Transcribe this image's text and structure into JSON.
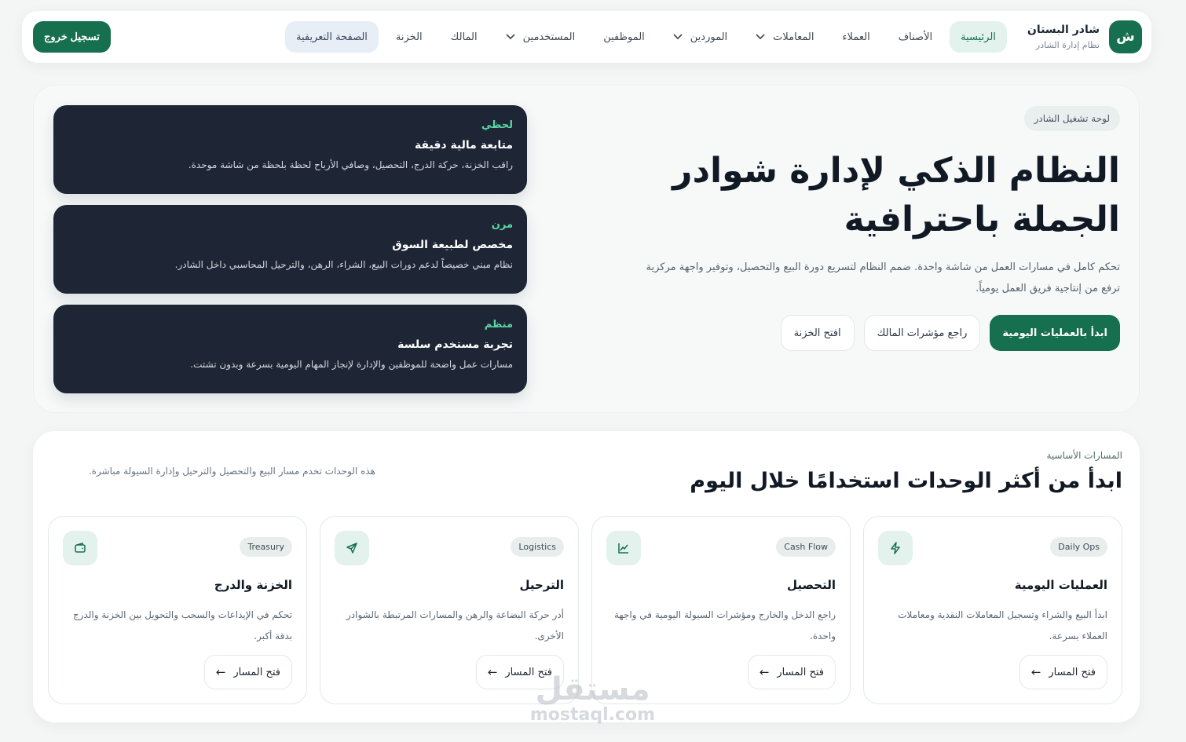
{
  "brand": {
    "initial": "ش",
    "name": "شادر البستان",
    "subtitle": "نظام إدارة الشادر"
  },
  "nav": {
    "items": [
      {
        "label": "الرئيسية",
        "active": true
      },
      {
        "label": "الأصناف"
      },
      {
        "label": "العملاء"
      },
      {
        "label": "المعاملات",
        "dropdown": true
      },
      {
        "label": "الموردين",
        "dropdown": true
      },
      {
        "label": "الموظفين"
      },
      {
        "label": "المستخدمين",
        "dropdown": true
      },
      {
        "label": "المالك"
      },
      {
        "label": "الخزنة"
      },
      {
        "label": "الصفحة التعريفية"
      }
    ],
    "logout_label": "تسجيل خروج"
  },
  "hero": {
    "pill": "لوحة تشغيل الشادر",
    "title": "النظام الذكي لإدارة شوادر الجملة باحترافية",
    "description": "تحكم كامل في مسارات العمل من شاشة واحدة. ضمم النظام لتسريع دورة البيع والتحصيل، وتوفير واجهة مركزية ترفع من إنتاجية فريق العمل يومياً.",
    "primary_button": "ابدأ بالعمليات اليومية",
    "secondary_button": "راجع مؤشرات المالك",
    "tertiary_button": "افتح الخزنة",
    "features": [
      {
        "tag": "لحظي",
        "title": "متابعة مالية دقيقة",
        "description": "راقب الخزنة، حركة الدرج، التحصيل، وصافي الأرباح لحظة بلحظة من شاشة موحدة."
      },
      {
        "tag": "مرن",
        "title": "مخصص لطبيعة السوق",
        "description": "نظام مبني خصيصاً لدعم دورات البيع، الشراء، الرهن، والترحيل المحاسبي داخل الشادر."
      },
      {
        "tag": "منظم",
        "title": "تجربة مستخدم سلسة",
        "description": "مسارات عمل واضحة للموظفين والإدارة لإنجاز المهام اليومية بسرعة وبدون تشتت."
      }
    ]
  },
  "paths": {
    "kicker": "المسارات الأساسية",
    "title": "ابدأ من أكثر الوحدات استخدامًا خلال اليوم",
    "description": "هذه الوحدات تخدم مسار البيع والتحصيل والترحيل وإدارة السيولة مباشرة.",
    "modules": [
      {
        "badge": "Daily Ops",
        "icon": "bolt-icon",
        "title": "العمليات اليومية",
        "description": "ابدأ البيع والشراء وتسجيل المعاملات النقدية ومعاملات العملاء بسرعة.",
        "button": "فتح المسار"
      },
      {
        "badge": "Cash Flow",
        "icon": "trend-chart-icon",
        "title": "التحصيل",
        "description": "راجع الدخل والخارج ومؤشرات السيولة اليومية في واجهة واحدة.",
        "button": "فتح المسار"
      },
      {
        "badge": "Logistics",
        "icon": "send-icon",
        "title": "الترحيل",
        "description": "أدر حركة البضاعة والرهن والمسارات المرتبطة بالشوادر الأخرى.",
        "button": "فتح المسار"
      },
      {
        "badge": "Treasury",
        "icon": "wallet-icon",
        "title": "الخزنة والدرج",
        "description": "تحكم في الإيداعات والسحب والتحويل بين الخزنة والدرج بدقة أكبر.",
        "button": "فتح المسار"
      }
    ]
  },
  "watermark": {
    "arabic": "مستقل",
    "latin": "mostaql.com"
  },
  "colors": {
    "brand_green": "#166f4e",
    "dark_card": "#1e2535",
    "accent_green": "#59d8a3",
    "page_bg": "#f3f6f5"
  }
}
